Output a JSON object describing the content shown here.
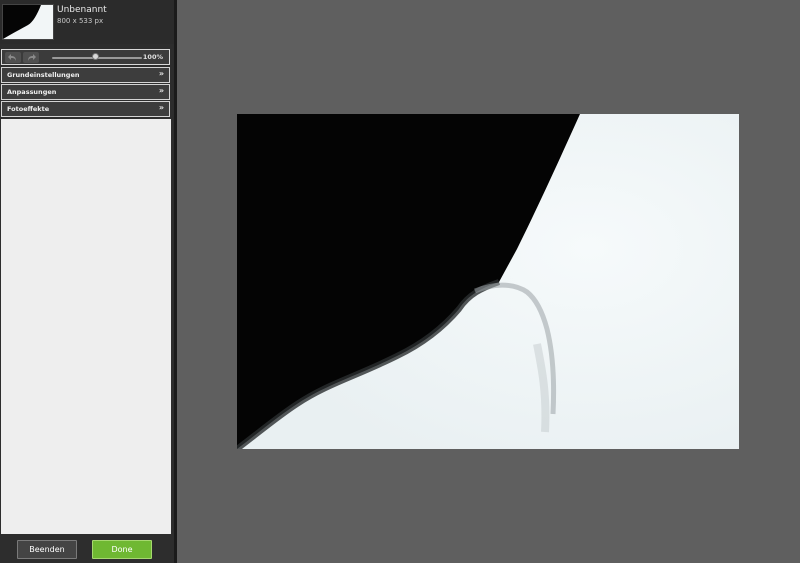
{
  "document": {
    "name": "Unbenannt",
    "dimensions": "800 x 533 px"
  },
  "toolbar": {
    "undo_icon": "undo-arrow-icon",
    "redo_icon": "redo-arrow-icon",
    "zoom_value": "100%",
    "zoom_level": 1.0
  },
  "sections": [
    {
      "label": "Grundeinstellungen",
      "icon": "double-chevron-down-icon"
    },
    {
      "label": "Anpassungen",
      "icon": "double-chevron-down-icon"
    },
    {
      "label": "Fotoeffekte",
      "icon": "double-chevron-down-icon"
    }
  ],
  "footer": {
    "quit_label": "Beenden",
    "done_label": "Done"
  },
  "colors": {
    "sidebar_bg": "#2d2d2d",
    "workspace_bg": "#5f5f5f",
    "panel_bg": "#eeeeee",
    "done_button": "#6fb832"
  }
}
